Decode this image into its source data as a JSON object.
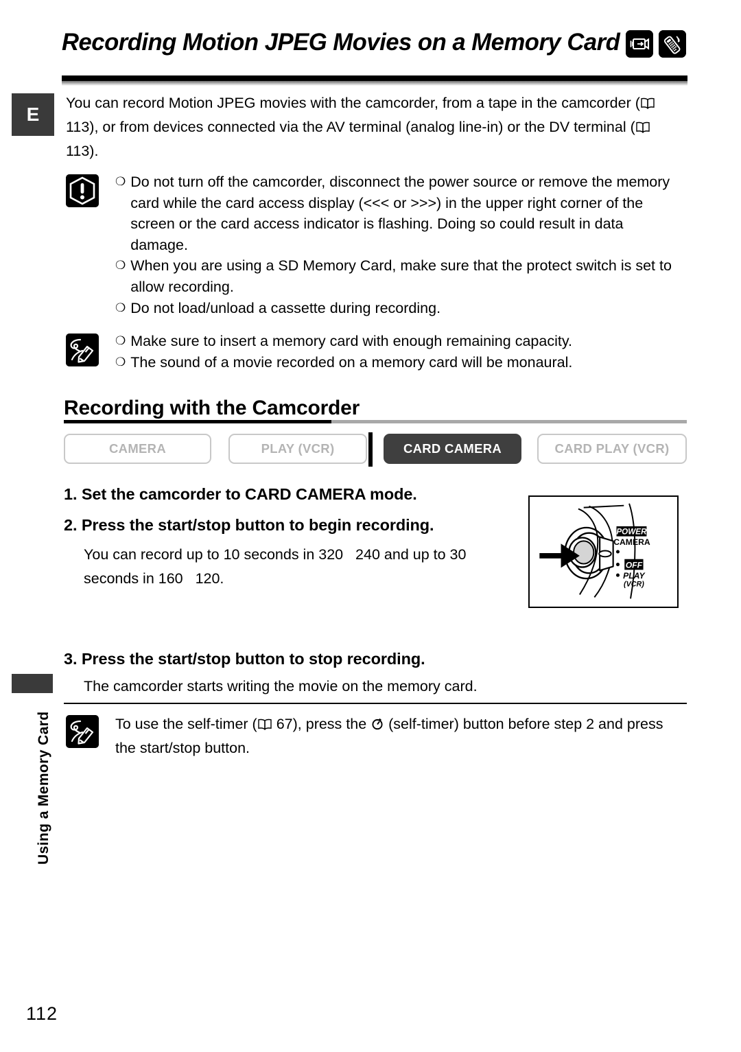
{
  "header": {
    "title": "Recording Motion JPEG Movies on a Memory Card",
    "icons": [
      "camcorder-icon",
      "remote-control-icon"
    ]
  },
  "margin": {
    "language_tab": "E",
    "chapter_label": "Using a Memory Card",
    "page_number": "112"
  },
  "intro": {
    "part1": "You can record Motion JPEG movies with the camcorder, from a tape in the camcorder (",
    "ref1": "113",
    "part2": "), or from devices connected via the AV terminal (analog line-in) or the DV terminal (",
    "ref2": "113",
    "part3": ")."
  },
  "warning": {
    "icon": "caution-exclamation-icon",
    "bullets": [
      "Do not turn off the camcorder, disconnect the power source or remove the memory card while the card access display (<<< or >>>) in the upper right corner of the screen or the card access indicator is flashing. Doing so could result in data damage.",
      "When you are using a SD Memory Card, make sure that the protect switch is set to allow recording.",
      "Do not load/unload a cassette during recording."
    ]
  },
  "note": {
    "icon": "note-pencil-icon",
    "bullets": [
      "Make sure to insert a memory card with enough remaining capacity.",
      "The sound of a movie recorded on a memory card will be monaural."
    ]
  },
  "section": {
    "heading": "Recording with the Camcorder",
    "modes": [
      {
        "label": "CAMERA",
        "active": false
      },
      {
        "label": "PLAY (VCR)",
        "active": false
      },
      {
        "label": "CARD CAMERA",
        "active": true
      },
      {
        "label": "CARD PLAY (VCR)",
        "active": false
      }
    ]
  },
  "steps": [
    {
      "number": "1.",
      "heading": "Set the camcorder to CARD CAMERA mode."
    },
    {
      "number": "2.",
      "heading": "Press the start/stop button to begin recording.",
      "body_part1": "You can record up to 10 seconds in 320",
      "body_res1": "240",
      "body_part2": "and up to 30 seconds in 160",
      "body_res2": "120."
    },
    {
      "number": "3.",
      "heading": "Press the start/stop button to stop recording.",
      "body": "The camcorder starts writing the movie on the memory card."
    }
  ],
  "figure": {
    "name": "power-dial-diagram",
    "labels": {
      "power": "POWER",
      "camera": "CAMERA",
      "off": "OFF",
      "play": "PLAY",
      "play_sub": "(VCR)"
    }
  },
  "bottom_note": {
    "icon": "note-pencil-icon",
    "part1": "To use the self-timer (",
    "ref": "67",
    "part2": "), press the",
    "part3": "(self-timer) button before step 2 and press the start/stop button."
  },
  "colors": {
    "tab_dark": "#3a3a3a",
    "mode_active_bg": "#3f3f3f",
    "mode_inactive_text": "#b4b4b4",
    "section_rule": "#a8a8a8"
  }
}
